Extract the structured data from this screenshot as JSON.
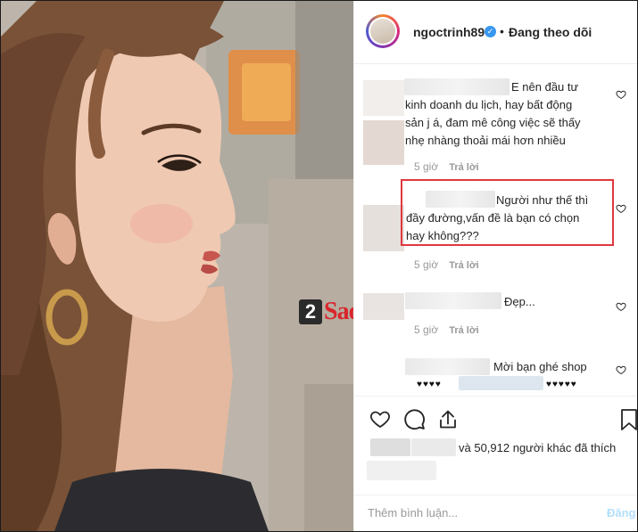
{
  "header": {
    "username": "ngoctrinh89",
    "dot": "•",
    "follow_label": "Đang theo dõi"
  },
  "watermark": {
    "number": "2",
    "text": "Sao"
  },
  "comments": [
    {
      "lines": [
        "E nên đầu tư",
        "kinh doanh du lịch, hay bất động",
        "sản j á, đam mê công việc sẽ thấy",
        "nhẹ nhàng thoải mái hơn nhiều"
      ],
      "time": "5 giờ",
      "reply": "Trả lời"
    },
    {
      "lines": [
        "Người như thế thì",
        "đầy đường,vấn đề là bạn có chọn",
        "hay không???"
      ],
      "time": "5 giờ",
      "reply": "Trả lời"
    },
    {
      "lines": [
        "Đẹp..."
      ],
      "time": "5 giờ",
      "reply": "Trả lời"
    },
    {
      "lines": [
        "Mời bạn ghé shop",
        "♥♥♥♥",
        "♥♥♥♥♥"
      ]
    }
  ],
  "icons": {
    "like": "heart-icon",
    "comment": "comment-icon",
    "share": "share-icon",
    "save": "bookmark-icon"
  },
  "likes": {
    "text": "và 50,912 người khác đã thích"
  },
  "add_comment": {
    "placeholder": "Thêm bình luận...",
    "post_label": "Đăng"
  }
}
